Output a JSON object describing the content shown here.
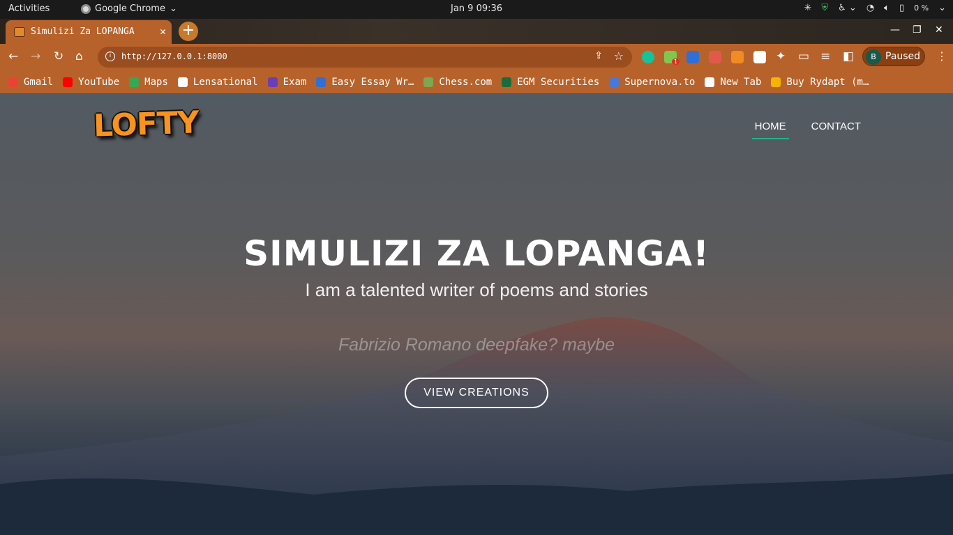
{
  "system_bar": {
    "activities": "Activities",
    "app_name": "Google Chrome",
    "clock": "Jan 9  09:36",
    "battery": "0 %"
  },
  "browser": {
    "tab_title": "Simulizi Za LOPANGA",
    "url": "http://127.0.0.1:8000",
    "profile_initial": "B",
    "profile_status": "Paused",
    "extension_badge": "1",
    "bookmarks": [
      {
        "label": "Gmail",
        "color": "#ea4335"
      },
      {
        "label": "YouTube",
        "color": "#ff0000"
      },
      {
        "label": "Maps",
        "color": "#34a853"
      },
      {
        "label": "Lensational",
        "color": "#ffffff"
      },
      {
        "label": "Exam",
        "color": "#6a3fb5"
      },
      {
        "label": "Easy Essay Wr…",
        "color": "#2f6fd6"
      },
      {
        "label": "Chess.com",
        "color": "#7fa650"
      },
      {
        "label": "EGM Securities",
        "color": "#1c6b3a"
      },
      {
        "label": "Supernova.to",
        "color": "#4a78d8"
      },
      {
        "label": "New Tab",
        "color": "#ffffff"
      },
      {
        "label": "Buy Rydapt (m…",
        "color": "#f4b400"
      }
    ]
  },
  "site": {
    "logo_text": "LOFTY",
    "nav": [
      "HOME",
      "CONTACT"
    ],
    "hero_title": "SIMULIZI ZA LOPANGA!",
    "hero_subtitle": "I am a talented writer of poems and stories",
    "typed_text": "Fabrizio Romano deepfake? maybe",
    "cta_label": "VIEW CREATIONS",
    "accent_color": "#22b58a"
  }
}
